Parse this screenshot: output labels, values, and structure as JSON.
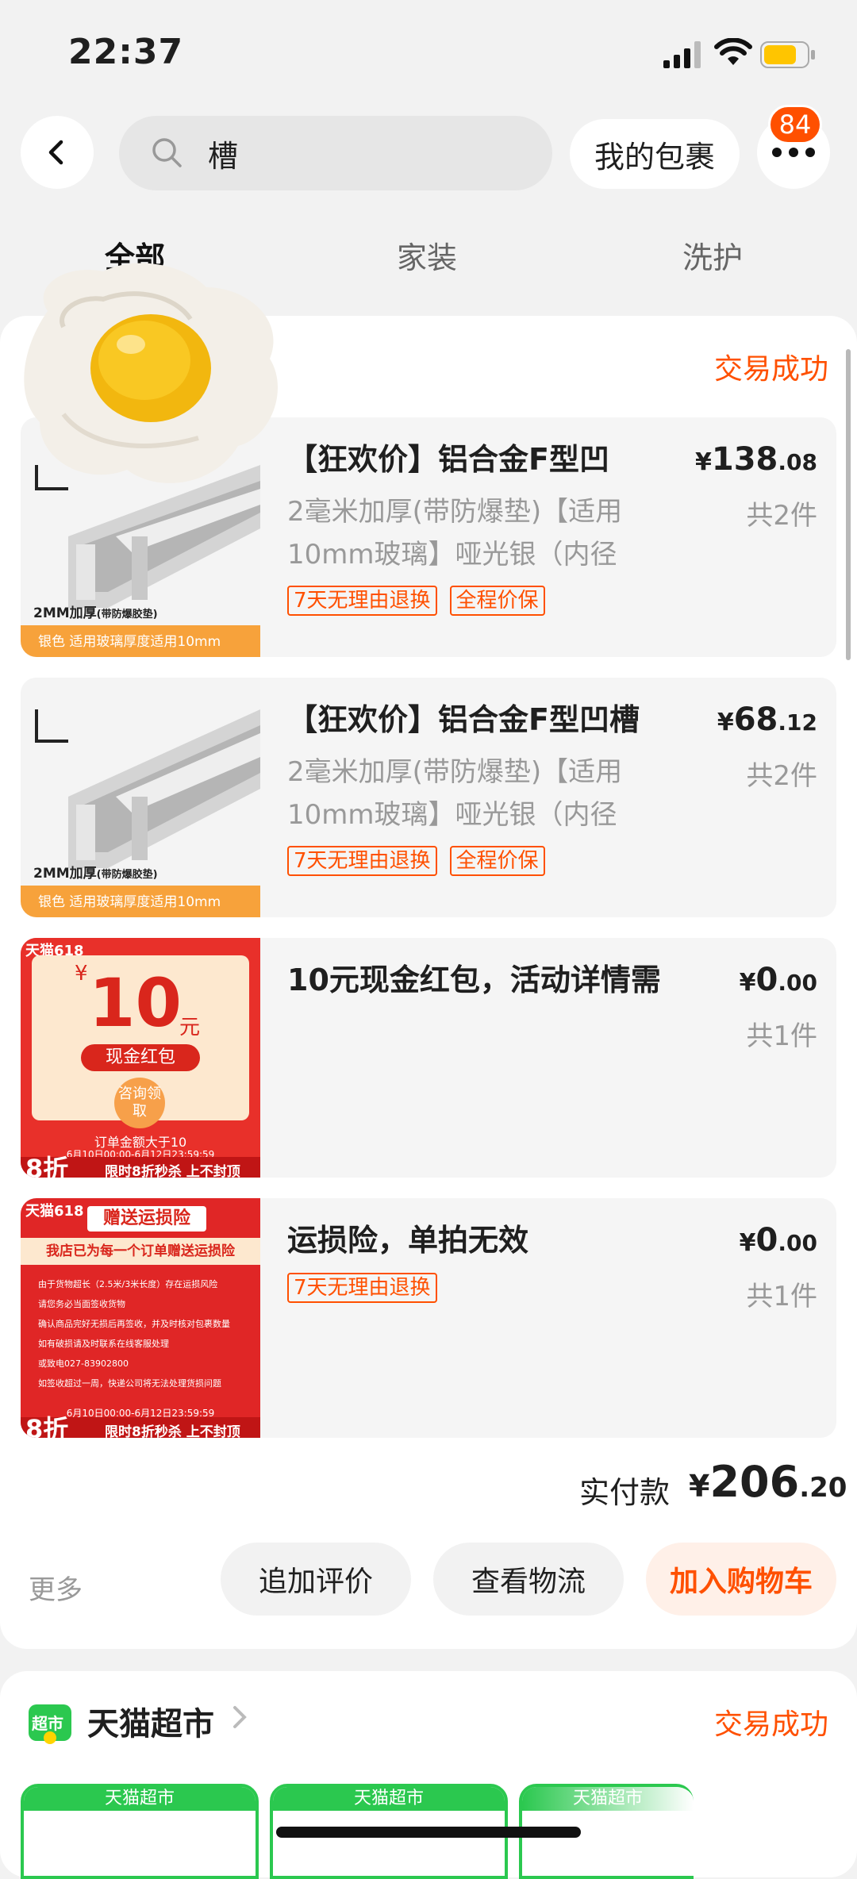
{
  "status_bar": {
    "time": "22:37"
  },
  "top_bar": {
    "search_text": "槽",
    "parcel_button": "我的包裹",
    "badge_count": "84"
  },
  "tabs": [
    {
      "label": "全部",
      "active": true
    },
    {
      "label": "家装",
      "active": false
    },
    {
      "label": "洗护",
      "active": false
    }
  ],
  "order1": {
    "status": "交易成功",
    "items": [
      {
        "title": "【狂欢价】铝合金F型凹",
        "desc": "2毫米加厚(带防爆垫)【适用10mm玻璃】哑光银（内径",
        "tags": [
          "7天无理由退换",
          "全程价保"
        ],
        "price_currency": "¥",
        "price_int": "138",
        "price_dec": ".08",
        "qty": "共2件",
        "thumb_caption1": "2MM加厚",
        "thumb_caption2": "(带防爆胶垫)",
        "thumb_band": "银色 适用玻璃厚度适用10mm"
      },
      {
        "title": "【狂欢价】铝合金F型凹槽",
        "desc": "2毫米加厚(带防爆垫)【适用10mm玻璃】哑光银（内径",
        "tags": [
          "7天无理由退换",
          "全程价保"
        ],
        "price_currency": "¥",
        "price_int": "68",
        "price_dec": ".12",
        "qty": "共2件",
        "thumb_caption1": "2MM加厚",
        "thumb_caption2": "(带防爆胶垫)",
        "thumb_band": "银色 适用玻璃厚度适用10mm"
      },
      {
        "title": "10元现金红包，活动详情需",
        "desc": "",
        "tags": [],
        "price_currency": "¥",
        "price_int": "0",
        "price_dec": ".00",
        "qty": "共1件",
        "thumb_top": "天猫618",
        "thumb_amount": "10",
        "thumb_unit": "元",
        "thumb_label": "现金红包",
        "thumb_btn": "咨询领取",
        "thumb_note": "订单金额大于10",
        "thumb_date": "6月10日00:00-6月12日23:59:59",
        "thumb_disc": "8折",
        "thumb_promo": "限时8折秒杀 上不封顶"
      },
      {
        "title": "运损险，单拍无效",
        "desc": "",
        "tags": [
          "7天无理由退换"
        ],
        "price_currency": "¥",
        "price_int": "0",
        "price_dec": ".00",
        "qty": "共1件",
        "thumb_top": "天猫618",
        "thumb_header": "赠送运损险",
        "thumb_subheader": "我店已为每一个订单赠送运损险",
        "thumb_lines": [
          "由于货物超长（2.5米/3米长度）存在运损风险",
          "请您务必当面签收货物",
          "确认商品完好无损后再签收，并及时核对包裹数量",
          "如有破损请及时联系在线客服处理",
          "或致电027-83902800",
          "如签收超过一周，快递公司将无法处理货损问题"
        ],
        "thumb_date": "6月10日00:00-6月12日23:59:59",
        "thumb_disc": "8折",
        "thumb_promo": "限时8折秒杀 上不封顶"
      }
    ],
    "total_label": "实付款",
    "total_currency": "¥",
    "total_int": "206",
    "total_dec": ".20",
    "more": "更多",
    "actions": [
      "追加评价",
      "查看物流",
      "加入购物车"
    ]
  },
  "order2": {
    "store_logo_text": "超市",
    "store_name": "天猫超市",
    "status": "交易成功",
    "thumb_headers": [
      "天猫超市",
      "天猫超市",
      "天猫超市"
    ]
  }
}
